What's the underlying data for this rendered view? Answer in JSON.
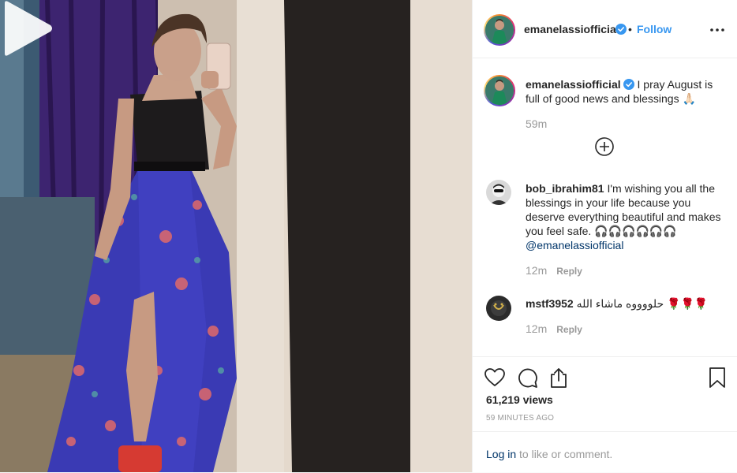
{
  "post": {
    "author": {
      "username": "emanelassiofficial",
      "verified": true,
      "avatar_icon": "profile-photo"
    },
    "header": {
      "separator": "•",
      "follow_label": "Follow",
      "more_icon": "ellipsis-icon"
    },
    "caption": {
      "username": "emanelassiofficial",
      "text": "I pray August is full of good news and blessings 🙏🏻",
      "time": "59m"
    },
    "load_more_icon": "plus-circle-icon",
    "comments": [
      {
        "username": "bob_ibrahim81",
        "text": "I'm wishing you all the blessings in your life because you deserve everything beautiful and makes you feel safe. 🎧🎧🎧🎧🎧🎧 ",
        "mention": "@emanelassiofficial",
        "time": "12m",
        "reply_label": "Reply"
      },
      {
        "username": "mstf3952",
        "text": "حلووووه ماشاء الله 🌹🌹🌹",
        "time": "12m",
        "reply_label": "Reply"
      }
    ],
    "actions": {
      "like_icon": "heart-icon",
      "comment_icon": "comment-icon",
      "share_icon": "share-icon",
      "save_icon": "bookmark-icon"
    },
    "views": "61,219 views",
    "timestamp": "59 MINUTES AGO",
    "login": {
      "link_label": "Log in",
      "suffix": " to like or comment."
    },
    "colors": {
      "accent": "#3897f0",
      "link": "#003569",
      "muted": "#999999",
      "text": "#262626",
      "border": "#efefef"
    }
  }
}
